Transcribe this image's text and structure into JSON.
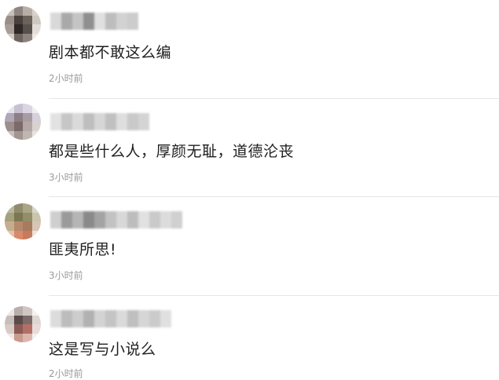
{
  "comments": [
    {
      "text": "剧本都不敢这么编",
      "time": "2小时前"
    },
    {
      "text": "都是些什么人，厚颜无耻，道德沦丧",
      "time": "3小时前"
    },
    {
      "text": "匪夷所思!",
      "time": "3小时前"
    },
    {
      "text": "这是写与小说么",
      "time": "2小时前"
    }
  ]
}
